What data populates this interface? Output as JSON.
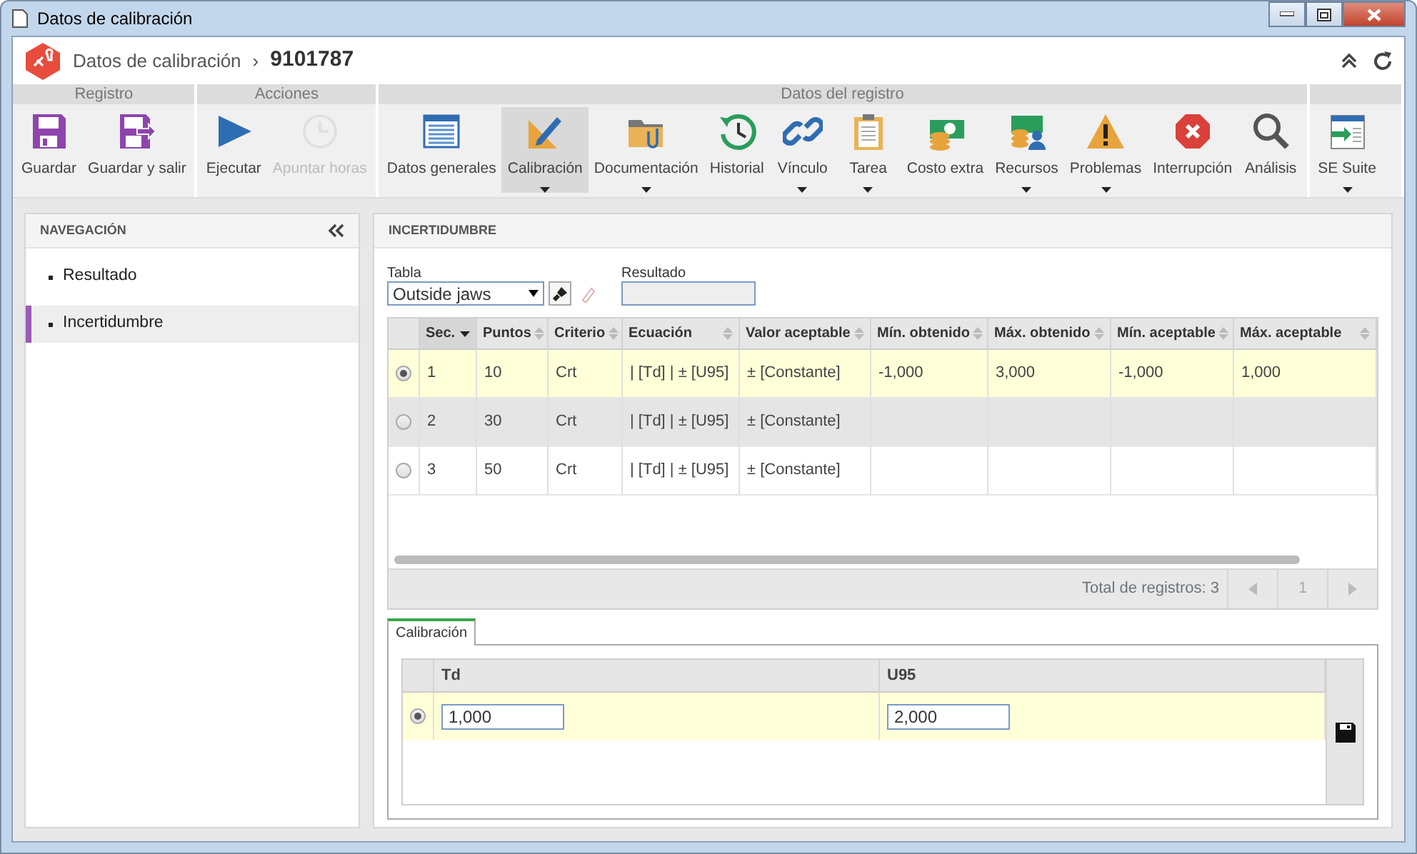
{
  "window": {
    "title": "Datos de calibración"
  },
  "header": {
    "breadcrumb": "Datos de calibración",
    "separator": "›",
    "record": "9101787"
  },
  "ribbon": {
    "groups": [
      {
        "title": "Registro",
        "buttons": [
          {
            "label": "Guardar",
            "disabled": false,
            "selected": false,
            "dropdown": false
          },
          {
            "label": "Guardar y salir",
            "disabled": false,
            "selected": false,
            "dropdown": false
          }
        ]
      },
      {
        "title": "Acciones",
        "buttons": [
          {
            "label": "Ejecutar",
            "disabled": false,
            "selected": false,
            "dropdown": false
          },
          {
            "label": "Apuntar horas",
            "disabled": true,
            "selected": false,
            "dropdown": false
          }
        ]
      },
      {
        "title": "Datos del registro",
        "buttons": [
          {
            "label": "Datos generales",
            "disabled": false,
            "selected": false,
            "dropdown": false
          },
          {
            "label": "Calibración",
            "disabled": false,
            "selected": true,
            "dropdown": true
          },
          {
            "label": "Documentación",
            "disabled": false,
            "selected": false,
            "dropdown": true
          },
          {
            "label": "Historial",
            "disabled": false,
            "selected": false,
            "dropdown": false
          },
          {
            "label": "Vínculo",
            "disabled": false,
            "selected": false,
            "dropdown": true
          },
          {
            "label": "Tarea",
            "disabled": false,
            "selected": false,
            "dropdown": true
          },
          {
            "label": "Costo extra",
            "disabled": false,
            "selected": false,
            "dropdown": false
          },
          {
            "label": "Recursos",
            "disabled": false,
            "selected": false,
            "dropdown": true
          },
          {
            "label": "Problemas",
            "disabled": false,
            "selected": false,
            "dropdown": true
          },
          {
            "label": "Interrupción",
            "disabled": false,
            "selected": false,
            "dropdown": false
          },
          {
            "label": "Análisis",
            "disabled": false,
            "selected": false,
            "dropdown": false
          }
        ]
      },
      {
        "buttons": [
          {
            "label": "SE Suite",
            "disabled": false,
            "selected": false,
            "dropdown": true
          }
        ]
      }
    ]
  },
  "navigation": {
    "title": "NAVEGACIÓN",
    "items": [
      {
        "label": "Resultado",
        "selected": false
      },
      {
        "label": "Incertidumbre",
        "selected": true
      }
    ]
  },
  "panel": {
    "title": "INCERTIDUMBRE",
    "tabla": {
      "label": "Tabla",
      "value": "Outside jaws"
    },
    "resultado": {
      "label": "Resultado"
    },
    "grid": {
      "columns": [
        {
          "label": "Sec.",
          "sorted": true
        },
        {
          "label": "Puntos",
          "sorted": false
        },
        {
          "label": "Criterio",
          "sorted": false
        },
        {
          "label": "Ecuación",
          "sorted": false
        },
        {
          "label": "Valor aceptable",
          "sorted": false
        },
        {
          "label": "Mín. obtenido",
          "sorted": false
        },
        {
          "label": "Máx. obtenido",
          "sorted": false
        },
        {
          "label": "Mín. aceptable",
          "sorted": false
        },
        {
          "label": "Máx. aceptable",
          "sorted": false
        }
      ],
      "rows": [
        {
          "selected": true,
          "hover": false,
          "cells": [
            "1",
            "10",
            "Crt",
            "| [Td] | ± [U95]",
            "± [Constante]",
            "-1,000",
            "3,000",
            "-1,000",
            "1,000"
          ]
        },
        {
          "selected": false,
          "hover": true,
          "cells": [
            "2",
            "30",
            "Crt",
            "| [Td] | ± [U95]",
            "± [Constante]"
          ]
        },
        {
          "selected": false,
          "hover": false,
          "cells": [
            "3",
            "50",
            "Crt",
            "| [Td] | ± [U95]",
            "± [Constante]"
          ]
        }
      ],
      "total": "Total de registros: 3",
      "page": "1"
    },
    "calibration": {
      "tab": "Calibración",
      "columns": [
        "Td",
        "U95"
      ],
      "rows": [
        {
          "selected": true,
          "values": [
            "1,000",
            "2,000"
          ]
        }
      ]
    }
  }
}
